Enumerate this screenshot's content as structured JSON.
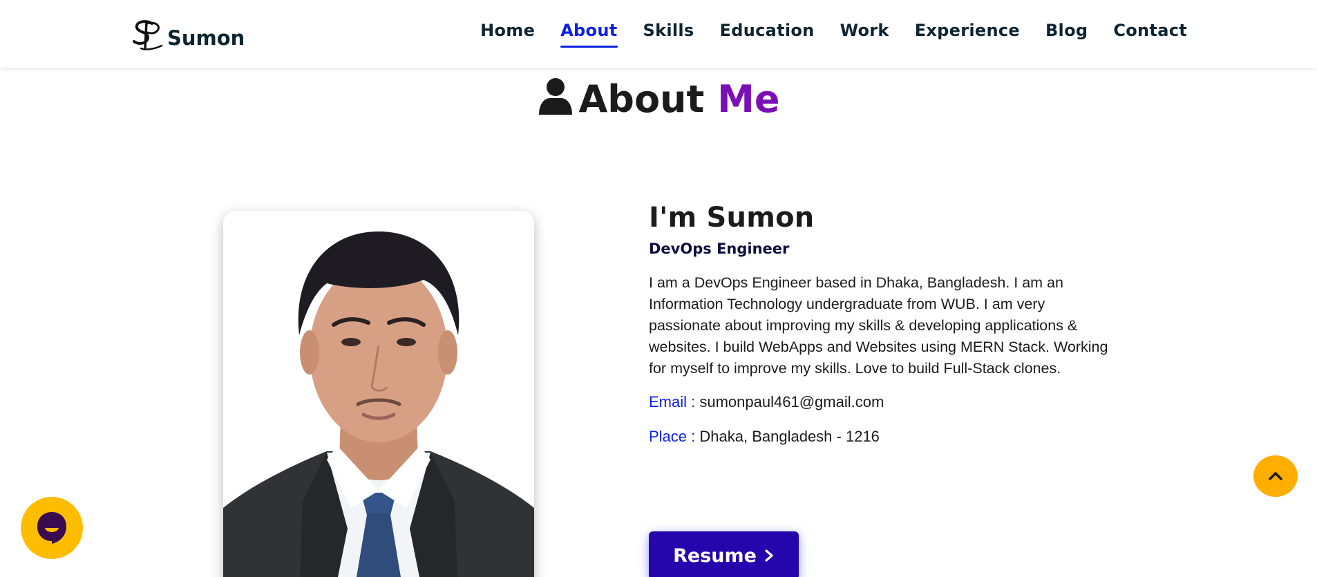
{
  "brand": {
    "name": "Sumon",
    "logo_icon": "sp-monogram-logo"
  },
  "nav": {
    "items": [
      {
        "label": "Home",
        "active": false
      },
      {
        "label": "About",
        "active": true
      },
      {
        "label": "Skills",
        "active": false
      },
      {
        "label": "Education",
        "active": false
      },
      {
        "label": "Work",
        "active": false
      },
      {
        "label": "Experience",
        "active": false
      },
      {
        "label": "Blog",
        "active": false
      },
      {
        "label": "Contact",
        "active": false
      }
    ],
    "active_color": "#0c1fe4"
  },
  "section": {
    "icon": "user-icon",
    "title_main": "About",
    "title_accent": "Me",
    "accent_color": "#7a0fb5"
  },
  "profile": {
    "photo_icon": "profile-photo",
    "greeting": "I'm Sumon",
    "role": "DevOps Engineer",
    "bio": "I am a DevOps Engineer based in Dhaka, Bangladesh. I am an Information Technology undergraduate from WUB. I am very passionate about improving my skills & developing applications & websites. I build WebApps and Websites using MERN Stack. Working for myself to improve my skills. Love to build Full-Stack clones.",
    "email_label": "Email :",
    "email": "sumonpaul461@gmail.com",
    "place_label": "Place :",
    "place": "Dhaka, Bangladesh - 1216",
    "resume_label": "Resume",
    "resume_icon": "chevron-right-icon",
    "resume_color": "#2506ad"
  },
  "floating": {
    "scroll_top_icon": "chevron-up-icon",
    "scroll_top_color": "#ffae00",
    "chat_icon": "chat-face-icon",
    "chat_color": "#ffbd00"
  }
}
